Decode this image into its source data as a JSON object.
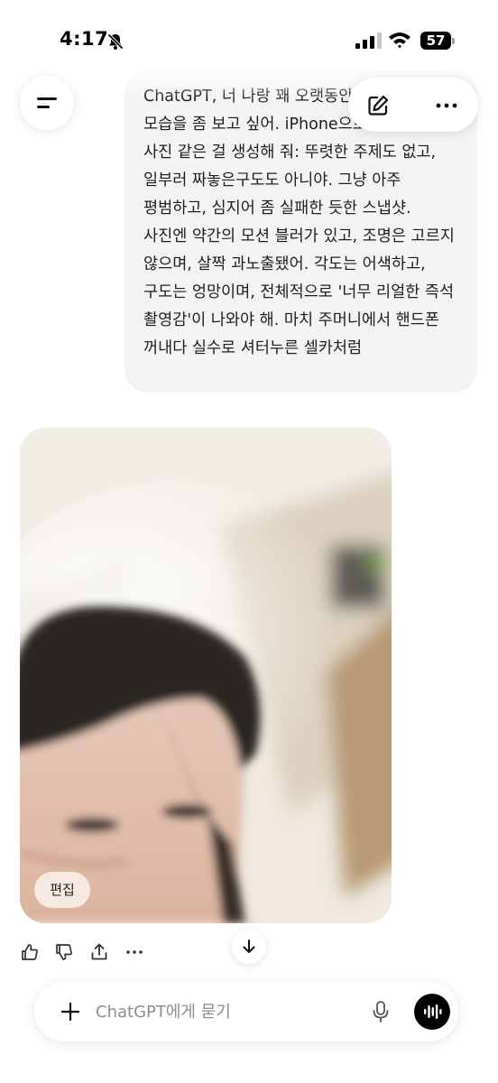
{
  "status_bar": {
    "time": "4:17",
    "battery": "57"
  },
  "conversation": {
    "user_message": "ChatGPT, 너 나랑 꽤 오랫동안 대화했잖아. 네 모습을 좀 보고 싶어. iPhone으로 막 찍은 스냅 사진 같은 걸 생성해 줘: 뚜렷한 주제도 없고, 일부러 짜놓은구도도 아니야. 그냥 아주 평범하고, 심지어 좀 실패한 듯한 스냅샷. 사진엔 약간의 모션 블러가 있고, 조명은 고르지 않으며, 살짝 과노출됐어. 각도는 어색하고, 구도는 엉망이며, 전체적으로 '너무 리얼한 즉석 촬영감'이 나와야 해. 마치 주머니에서 핸드폰 꺼내다 실수로 셔터누른 셀카처럼",
    "image_edit_label": "편집"
  },
  "composer": {
    "placeholder": "ChatGPT에게 묻기"
  },
  "icons": {
    "menu": "menu-icon",
    "new_chat": "edit-icon",
    "more": "more-icon",
    "thumbs_up": "thumbs-up-icon",
    "thumbs_down": "thumbs-down-icon",
    "share": "share-icon",
    "scroll_down": "arrow-down-icon",
    "add": "plus-icon",
    "mic": "mic-icon",
    "voice": "voice-mode-icon"
  },
  "colors": {
    "user_bubble": "#f3f3f3",
    "edit_chip": "#f6e9e2",
    "voice_button": "#000000"
  }
}
